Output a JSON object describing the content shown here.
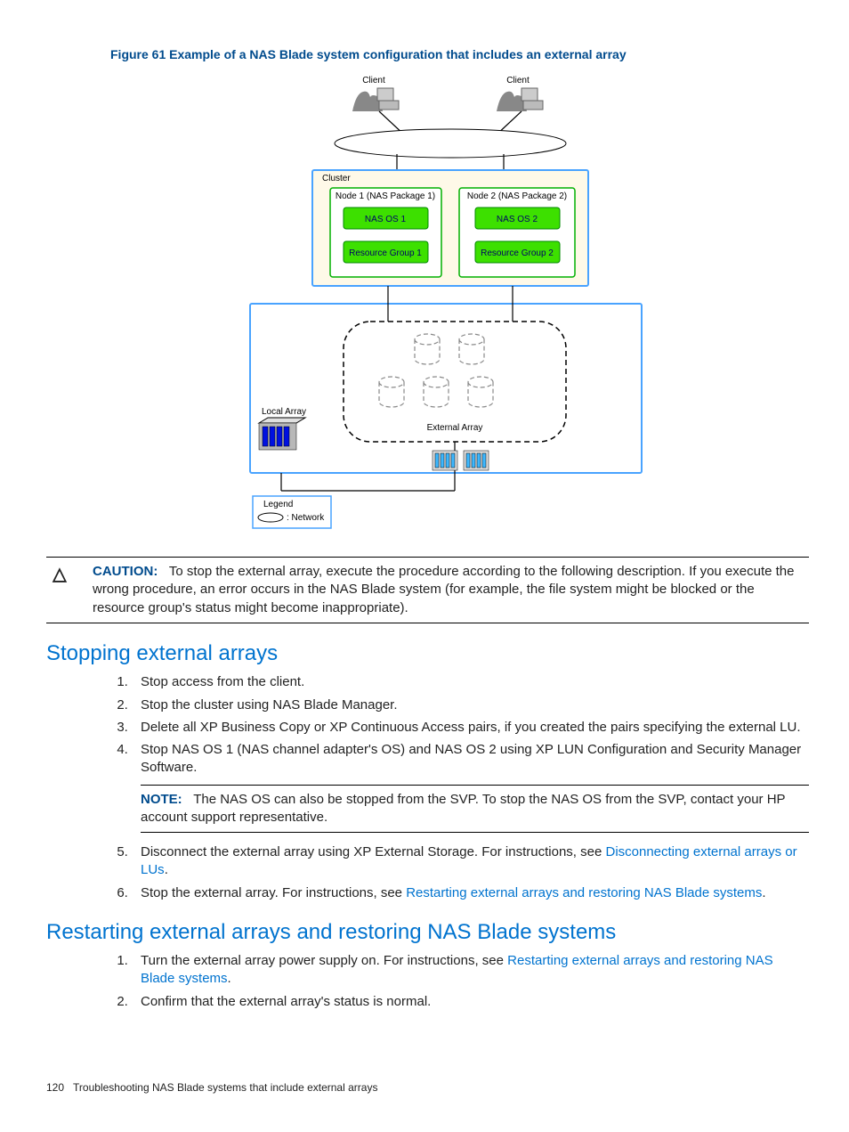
{
  "figure": {
    "title": "Figure 61 Example of a NAS Blade system configuration that includes an external array",
    "labels": {
      "client": "Client",
      "cluster": "Cluster",
      "node1": "Node 1 (NAS Package 1)",
      "node2": "Node 2 (NAS Package 2)",
      "nasos1": "NAS OS 1",
      "nasos2": "NAS OS 2",
      "rg1": "Resource Group 1",
      "rg2": "Resource Group 2",
      "local_array": "Local Array",
      "external_array": "External Array",
      "legend": "Legend",
      "network": ": Network"
    }
  },
  "caution": {
    "label": "CAUTION:",
    "text": "To stop the external array, execute the procedure according to the following description. If you execute the wrong procedure, an error occurs in the NAS Blade system (for example, the file system might be blocked or the resource group's status might become inappropriate)."
  },
  "section1": {
    "heading": "Stopping external arrays",
    "steps": [
      "Stop access from the client.",
      "Stop the cluster using NAS Blade Manager.",
      "Delete all XP Business Copy or XP Continuous Access pairs, if you created the pairs specifying the external LU.",
      "Stop NAS OS 1 (NAS channel adapter's OS) and NAS OS 2 using XP LUN Configuration and Security Manager Software."
    ],
    "note": {
      "label": "NOTE:",
      "text": "The NAS OS can also be stopped from the SVP. To stop the NAS OS from the SVP, contact your HP account support representative."
    },
    "step5_pre": "Disconnect the external array using XP External Storage. For instructions, see ",
    "step5_link": "Disconnecting external arrays or LUs",
    "step5_post": ".",
    "step6_pre": "Stop the external array. For instructions, see ",
    "step6_link": "Restarting external arrays and restoring NAS Blade systems",
    "step6_post": "."
  },
  "section2": {
    "heading": "Restarting external arrays and restoring NAS Blade systems",
    "step1_pre": "Turn the external array power supply on. For instructions, see ",
    "step1_link": "Restarting external arrays and restoring NAS Blade systems",
    "step1_post": ".",
    "step2": "Confirm that the external array's status is normal."
  },
  "footer": {
    "page": "120",
    "title": "Troubleshooting NAS Blade systems that include external arrays"
  }
}
